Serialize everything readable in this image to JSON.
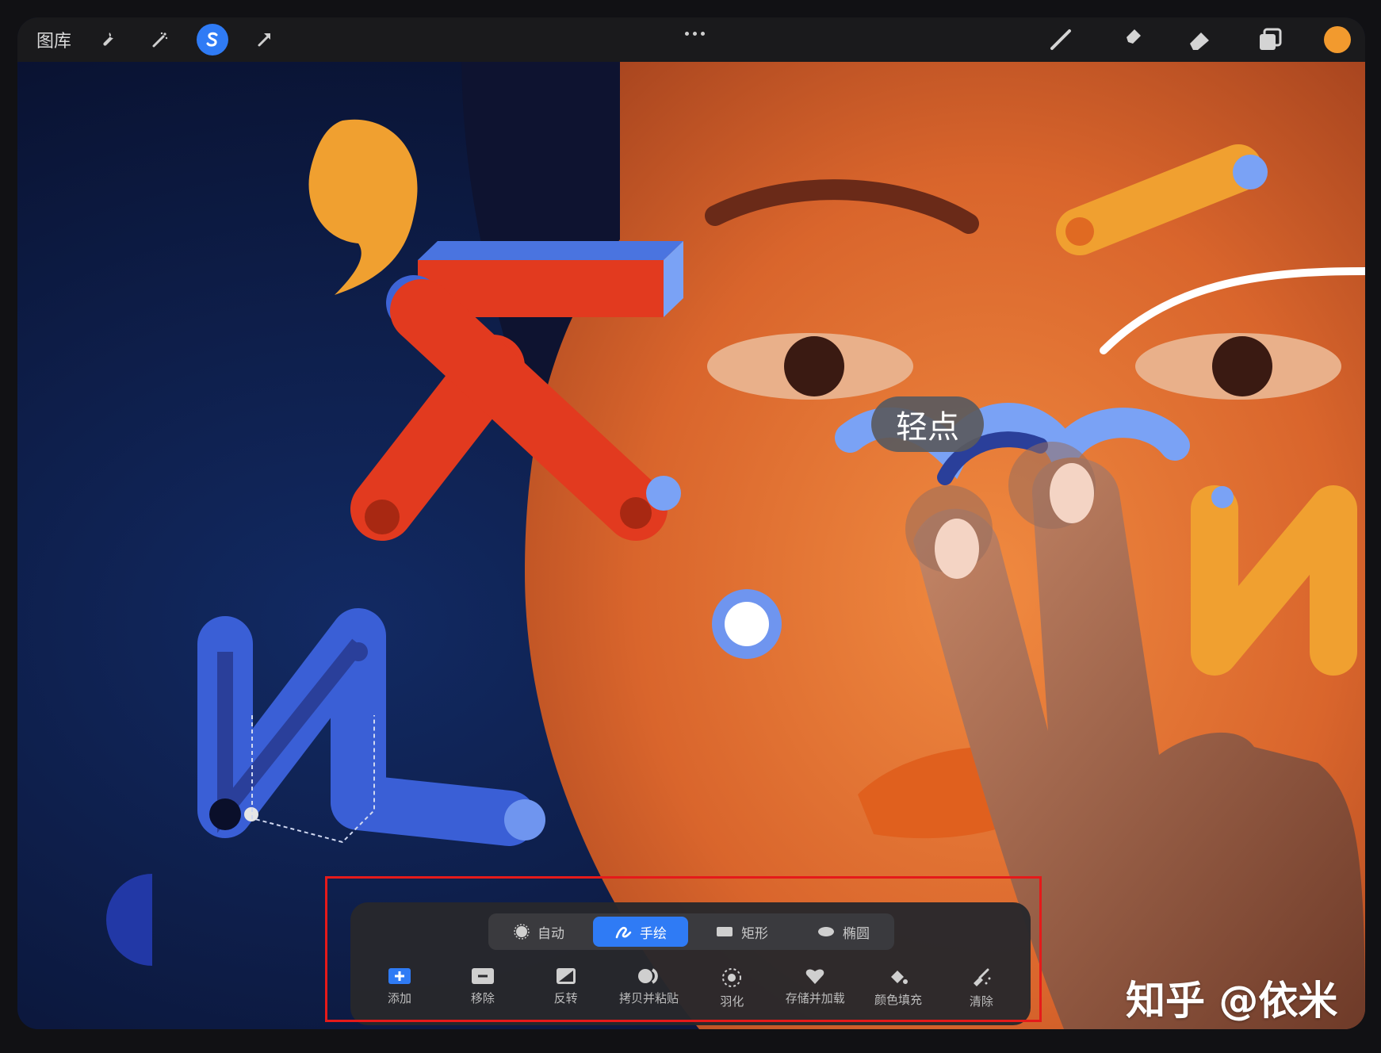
{
  "toolbar": {
    "gallery_label": "图库",
    "left_icons": [
      "wrench-icon",
      "magic-wand-icon",
      "selection-s-icon",
      "transform-arrow-icon"
    ],
    "right_icons": [
      "brush-icon",
      "smudge-icon",
      "eraser-icon",
      "layers-icon"
    ],
    "active_tool": "selection",
    "current_color": "#f29a2e",
    "accent": "#2f7bf5"
  },
  "gesture_hint": {
    "label": "轻点"
  },
  "selection_panel": {
    "modes": [
      {
        "label": "自动",
        "icon": "auto-burst-icon",
        "active": false
      },
      {
        "label": "手绘",
        "icon": "freehand-icon",
        "active": true
      },
      {
        "label": "矩形",
        "icon": "rectangle-icon",
        "active": false
      },
      {
        "label": "椭圆",
        "icon": "ellipse-icon",
        "active": false
      }
    ],
    "actions": [
      {
        "label": "添加",
        "icon": "add-icon"
      },
      {
        "label": "移除",
        "icon": "remove-icon"
      },
      {
        "label": "反转",
        "icon": "invert-icon"
      },
      {
        "label": "拷贝并粘贴",
        "icon": "copy-paste-icon"
      },
      {
        "label": "羽化",
        "icon": "feather-icon"
      },
      {
        "label": "存储并加载",
        "icon": "heart-icon"
      },
      {
        "label": "颜色填充",
        "icon": "color-fill-icon"
      },
      {
        "label": "清除",
        "icon": "clear-icon"
      }
    ]
  },
  "watermark": "知乎 @依米"
}
